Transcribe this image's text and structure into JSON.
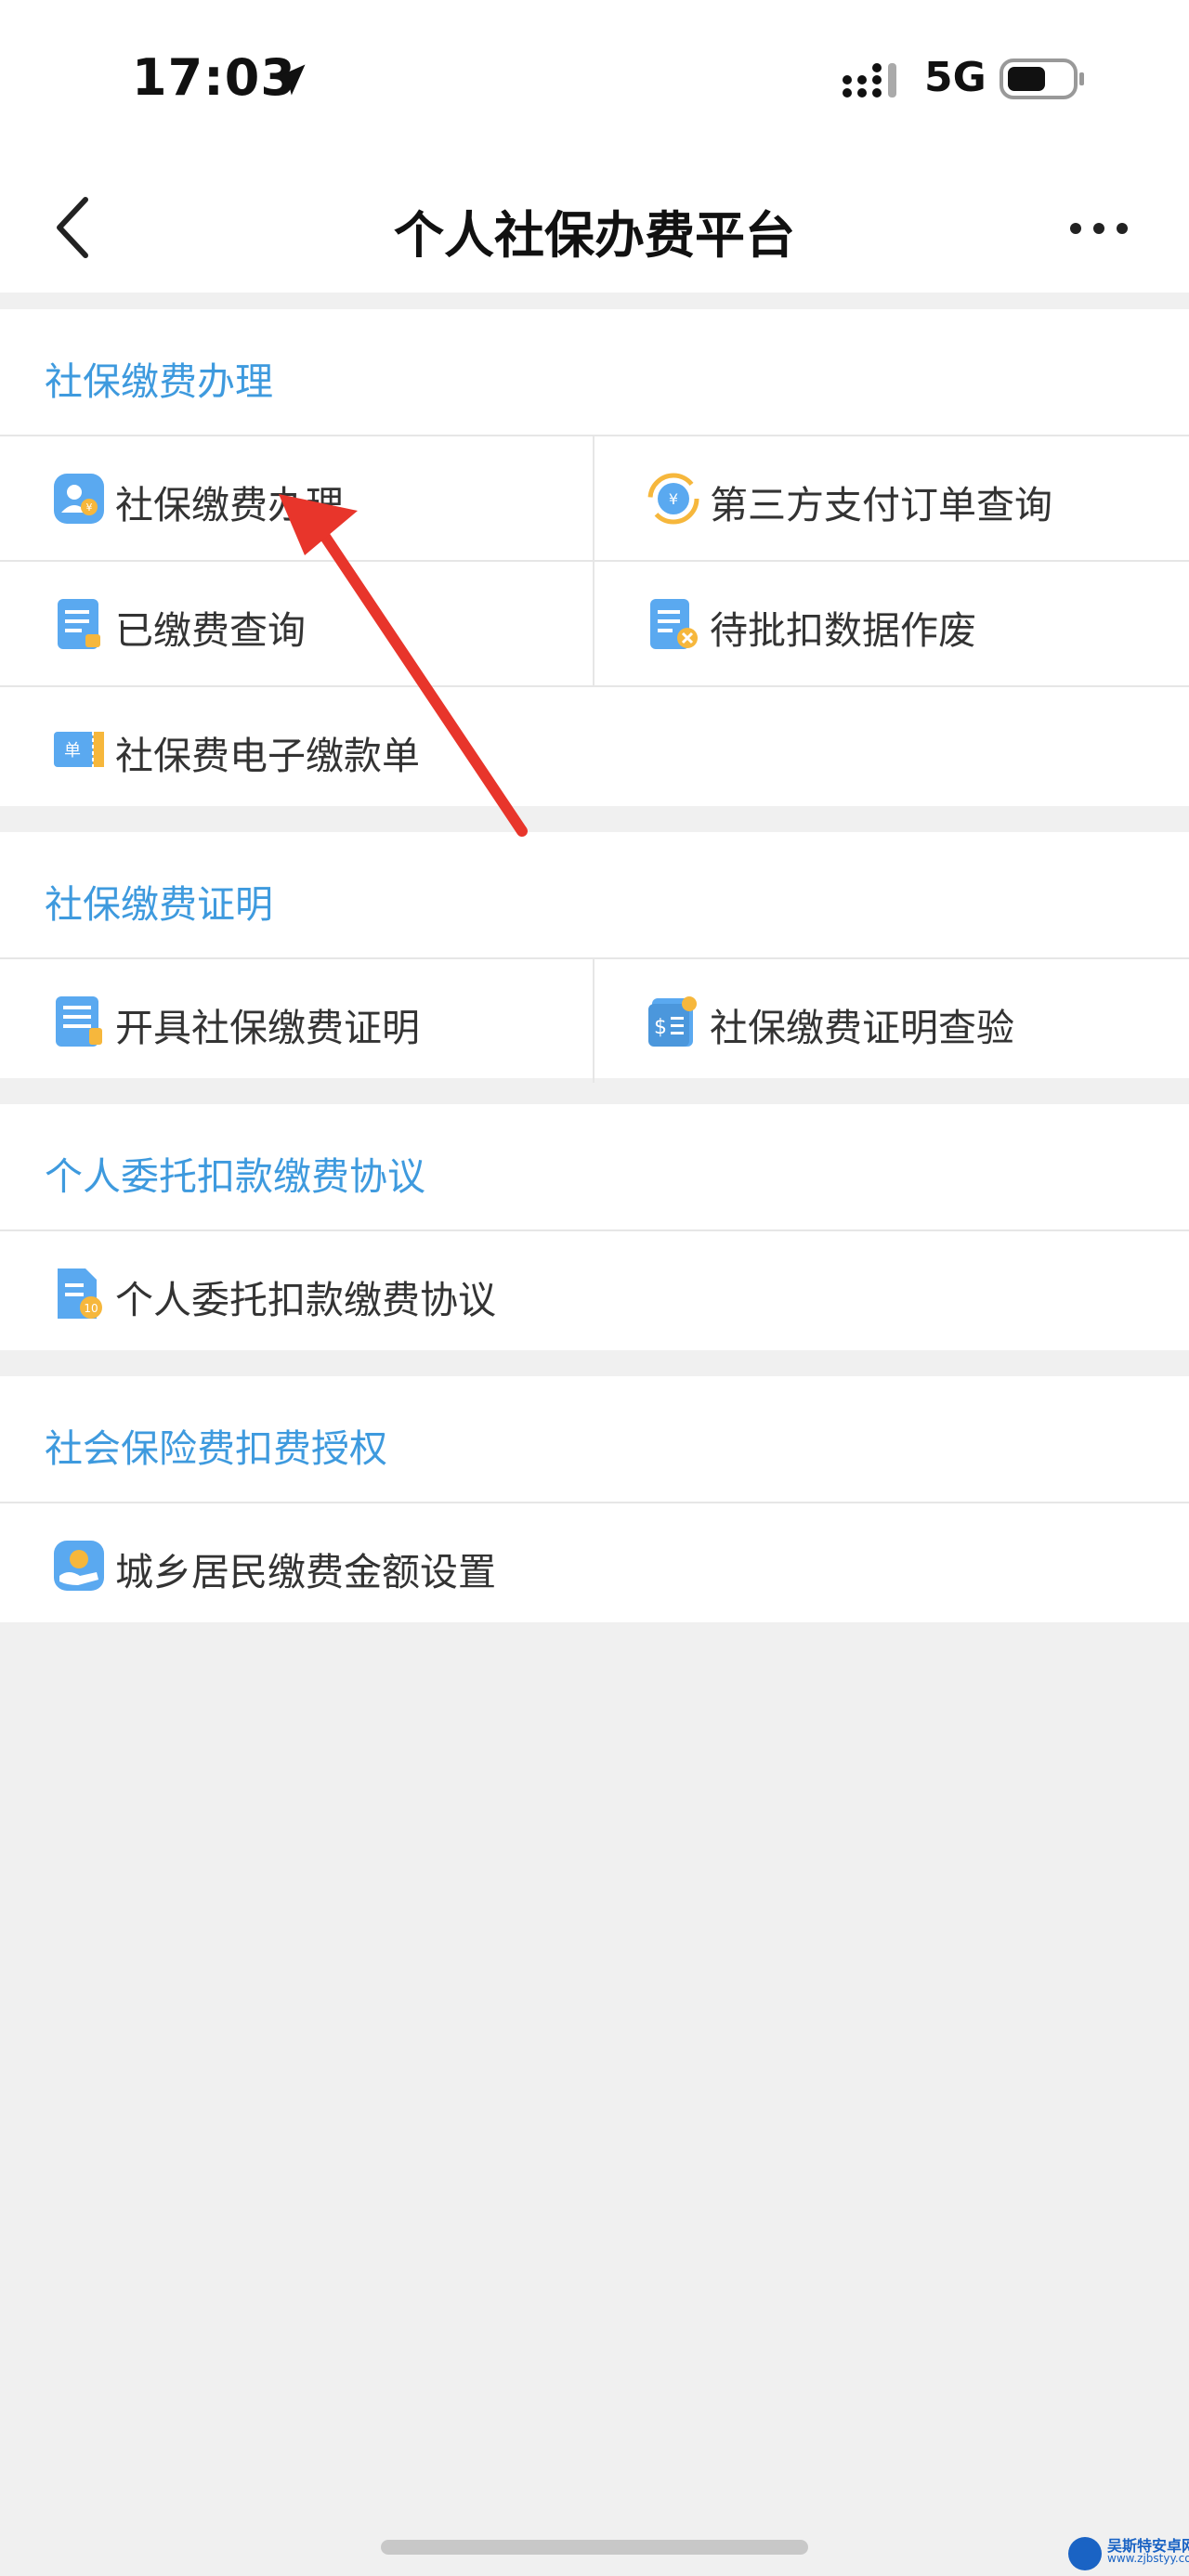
{
  "status_bar": {
    "time": "17:03",
    "network": "5G",
    "icons": [
      "location-arrow-icon",
      "signal-icon",
      "battery-icon"
    ]
  },
  "nav": {
    "title": "个人社保办费平台",
    "back_icon": "chevron-left-icon",
    "more_icon": "more-dots-icon"
  },
  "sections": [
    {
      "title": "社保缴费办理",
      "items": [
        {
          "label": "社保缴费办理",
          "icon": "social-security-pay-icon"
        },
        {
          "label": "第三方支付订单查询",
          "icon": "third-party-payment-icon"
        },
        {
          "label": "已缴费查询",
          "icon": "paid-query-icon"
        },
        {
          "label": "待批扣数据作废",
          "icon": "cancel-deduction-icon"
        },
        {
          "label": "社保费电子缴款单",
          "icon": "e-receipt-icon"
        }
      ]
    },
    {
      "title": "社保缴费证明",
      "items": [
        {
          "label": "开具社保缴费证明",
          "icon": "issue-certificate-icon"
        },
        {
          "label": "社保缴费证明查验",
          "icon": "verify-certificate-icon"
        }
      ]
    },
    {
      "title": "个人委托扣款缴费协议",
      "items": [
        {
          "label": "个人委托扣款缴费协议",
          "icon": "agreement-icon"
        }
      ]
    },
    {
      "title": "社会保险费扣费授权",
      "items": [
        {
          "label": "城乡居民缴费金额设置",
          "icon": "amount-setting-icon"
        }
      ]
    }
  ],
  "watermark": {
    "text": "吴斯特安卓网",
    "url": "www.zjbstyy.com"
  },
  "colors": {
    "accent": "#3e9ade",
    "background": "#f0f0f0",
    "annotation": "#e8352b"
  }
}
